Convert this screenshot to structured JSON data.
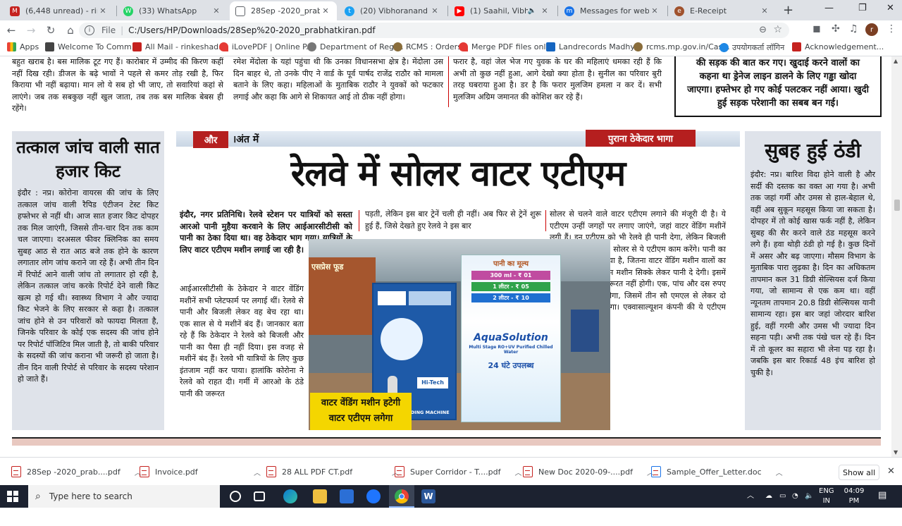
{
  "tabs": [
    {
      "title": "(6,448 unread) - rinkesha",
      "icon": "M",
      "color": "#c5221f"
    },
    {
      "title": "(33) WhatsApp",
      "icon": "W",
      "color": "#25d366"
    },
    {
      "title": "28Sep -2020_prabhatkira",
      "icon": "P",
      "color": "#5f6368"
    },
    {
      "title": "(20) Vibhoranand advoca",
      "icon": "t",
      "color": "#1da1f2"
    },
    {
      "title": "(1) Saahil, Vibhor, Tig",
      "icon": "▶",
      "color": "#ff0000"
    },
    {
      "title": "Messages for web",
      "icon": "m",
      "color": "#1a73e8"
    },
    {
      "title": "E-Receipt",
      "icon": "e",
      "color": "#a0522d"
    }
  ],
  "toolbar": {
    "file_label": "File",
    "url": "C:/Users/HP/Downloads/28Sep%20-2020_prabhatkiran.pdf",
    "avatar_letter": "r"
  },
  "bookmarks": [
    {
      "label": "Apps",
      "color": "#1a73e8"
    },
    {
      "label": "Welcome To Comm...",
      "color": "#444"
    },
    {
      "label": "All Mail - rinkeshad...",
      "color": "#c5221f"
    },
    {
      "label": "iLovePDF | Online P...",
      "color": "#e53935"
    },
    {
      "label": "Department of Regi...",
      "color": "#555"
    },
    {
      "label": "RCMS : Orders",
      "color": "#8a6d3b"
    },
    {
      "label": "Merge PDF files onl...",
      "color": "#e53935"
    },
    {
      "label": "Landrecords Madhy...",
      "color": "#1565c0"
    },
    {
      "label": "rcms.mp.gov.in/Cas...",
      "color": "#8a6d3b"
    },
    {
      "label": "उपयोगकर्ता लॉगिन",
      "color": "#1e88e5"
    },
    {
      "label": "Acknowledgement...",
      "color": "#c5221f"
    }
  ],
  "paper": {
    "top_col1": "बहुत खराब है। बस मालिक टूट गए हैं। कारोबार में उम्मीद की किरण कहीं नहीं दिख रही। डीजल के बढ़े भावों ने पहले से कमर तोड़ रखी है, फिर किराया भी नहीं बढ़ाया। मान लो ये सब हो भी जाए, तो सवारियां कहां से लाएंगे। जब तक सबकुछ नहीं खुल जाता, तब तक बस मालिक बेबस ही रहेंगे।",
    "top_col2": "रमेश मेंदोला के यहां पहुंचा थी कि उनका विधानसभा क्षेत्र है। मेंदोला उस दिन बाहर थे, तो उनके पीए ने वार्ड के पूर्व पार्षद राजेंद्र राठौर को मामला बताने के लिए कहा। महिलाओं के मुताबिक राठौर ने युवकों को फटकार लगाई और कहा कि आगे से शिकायत आई तो ठीक नहीं होगा।",
    "top_col3": "फरार है, वहां जेल भेज गए युवक के घर की महिलाएं धमका रही हैं कि अभी तो कुछ नहीं हुआ, आगे देखो क्या होता है। सुनील का परिवार बुरी तरह घबराया हुआ है। डर है कि फरार मुलजिम हमला न कर दें। सभी मुलजिम अग्रिम जमानत की कोशिश कर रहे हैं।",
    "top_box": "की सड़क की बात कर गए। खुदाई करने वालों का कहना था ड्रेनेज लाइन डालने के लिए गड्ढा खोदा जाएगा। हफ्तेभर हो गए कोई पलटकर नहीं आया। खुदी हुई सड़क परेशानी का सबब बन गई।",
    "left_title": "तत्काल जांच वाली सात हजार किट",
    "left_body": "इंदौर : नप्र। कोरोना वायरस की जांच के लिए तत्काल जांच वाली रैपिड एंटीजन टेस्ट किट हफ्तेभर से नहीं थी। आज सात हजार किट दोपहर तक मिल जाएंगी, जिससे तीन-चार दिन तक काम चल जाएगा। दरअसल फीवर क्लिनिक का समय सुबह आठ से रात आठ बजे तक होने के कारण लगातार लोग जांच कराने जा रहे हैं। अभी तीन दिन में रिपोर्ट आने वाली जांच तो लगातार हो रही है, लेकिन तत्काल जांच करके रिपोर्ट देने वाली किट खत्म हो गई थी। स्वास्थ्य विभाग ने और ज्यादा किट भेजने के लिए सरकार से कहा है। तत्काल जांच होने से उन परिवारों को फायदा मिलता है, जिनके परिवार के कोई एक सदस्य की जांच होने पर रिपोर्ट पॉजिटिव मिल जाती है, तो बाकी परिवार के सदस्यों की जांच कराना भी जरूरी हो जाता है। तीन दिन वाली रिपोर्ट से परिवार के सदस्य परेशान हो जाते हैं।",
    "section_tag_1": "और",
    "section_tag_2": "।अंत में",
    "kicker": "पुराना ठेकेदार भागा",
    "headline": "रेलवे में सोलर वाटर एटीएम",
    "lead": "इंदौर, नगर प्रतिनिधि। रेलवे स्टेशन पर यात्रियों को सस्ता आरओ पानी मुहैया करवाने के लिए आईआरसीटीसी को पानी का ठेका दिया था। वह ठेकेदार भाग गया। यात्रियों के लिए वाटर एटीएम मशीन लगाई जा रही है।",
    "col_a": "आईआरसीटीसी के ठेकेदार ने वाटर वेंडिंग मशीनें सभी प्लेटफार्म पर लगाई थीं। रेलवे से पानी और बिजली लेकर वह बेच रहा था। एक साल से ये मशीनें बंद हैं। जानकार बता रहे हैं कि ठेकेदार ने रेलवे को बिजली और पानी का पैसा ही नहीं दिया। इस वजह से मशीनें बंद हैं। रेलवे भी यात्रियों के लिए कुछ इंतजाम नहीं कर पाया। हालांकि कोरोना ने रेलवे को राहत दी। गर्मी में आरओ के ठंडे पानी की जरूरत",
    "col_b": "पड़ती, लेकिन इस बार ट्रेनें चली ही नहीं। अब फिर से ट्रेनें शुरू हुई हैं, जिसे देखते हुए रेलवे ने इस बार",
    "col_c": "सोलर से चलने वाले वाटर एटीएम लगाने की मंजूरी दी है। ये एटीएम उन्हीं जगहों पर लगाए जाएंगे, जहां वाटर वेंडिंग मशीनें लगी हैं। इन एटीएम को भी रेलवे ही पानी देगा, लेकिन बिजली की जरूरत नहीं होगी। सोलर से ये एटीएम काम करेंगे। पानी का दाम उतना ही रखा गया है, जितना वाटर वेंडिंग मशीन वालों का था। हालांकि ये एटीएम मशीन सिक्के लेकर पानी दे देगी। इसमें किसी कर्मचारी की जरूरत नहीं होगी। एक, पांच और दस रुपए का सिक्का डालना होगा, जिसमें तीन सौ एमएल से लेकर दो लीटर तक पानी मिलेगा। एक्वासाल्यूशन कंपनी की ये एटीएम लगने को तैयार हैं।",
    "caption_1": "वाटर वेंडिंग मशीन हटेगी",
    "caption_2": "वाटर एटीएम लगेगा",
    "photo_price_title": "पानी का मूल्य",
    "photo_prices": [
      "300 ml - ₹ 01",
      "1 लीटर - ₹ 05",
      "2 लीटर - ₹ 10"
    ],
    "photo_brand": "AquaSolution",
    "photo_sub": "Multi Stage RO+UV Purified Chilled Water",
    "photo_hours": "24 घंटे उपलब्ध",
    "photo_machine_label": "WATER VENDING MACHINE",
    "photo_hitech": "Hi-Tech",
    "photo_shop": "एसप्रेस फूड",
    "right_title": "सुबह हुई ठंडी",
    "right_body": "इंदौर: नप्र। बारिश विदा होने वाली है और सर्दी की दस्तक का वक्त आ गया है। अभी तक जहां गर्मी और उमस से हाल-बेहाल थे, वहीं अब सुकून महसूस किया जा सकता है। दोपहर में तो कोई खास फर्क नहीं है, लेकिन सुबह की सैर करने वाले ठंड महसूस करने लगे हैं। हवा थोड़ी ठंडी हो गई है। कुछ दिनों में असर और बढ़ जाएगा। मौसम विभाग के मुताबिक पारा लुढ़का है। दिन का अधिकतम तापमान कल 31 डिग्री सेल्सियस दर्ज किया गया, जो सामान्य से एक कम था। वहीं न्यूनतम तापमान 20.8 डिग्री सेल्सियस यानी सामान्य रहा। इस बार जहां जोरदार बारिश हुई, वहीं गरमी और उमस भी ज्यादा दिन सहना पड़ी। अभी तक पंखे चल रहे हैं। दिन में तो कूलर का सहारा भी लेना पड़ रहा है। जबकि इस बार रिकार्ड 48 इंच बारिश हो चुकी है।"
  },
  "downloads": [
    "28Sep -2020_prab....pdf",
    "Invoice.pdf",
    "28 ALL PDF CT.pdf",
    "Super Corridor - T....pdf",
    "New Doc 2020-09-....pdf",
    "Sample_Offer_Letter.doc"
  ],
  "show_all": "Show all",
  "taskbar": {
    "search_placeholder": "Type here to search",
    "lang1": "ENG",
    "lang2": "IN",
    "time": "04:09 PM",
    "date": "28-09-20"
  }
}
